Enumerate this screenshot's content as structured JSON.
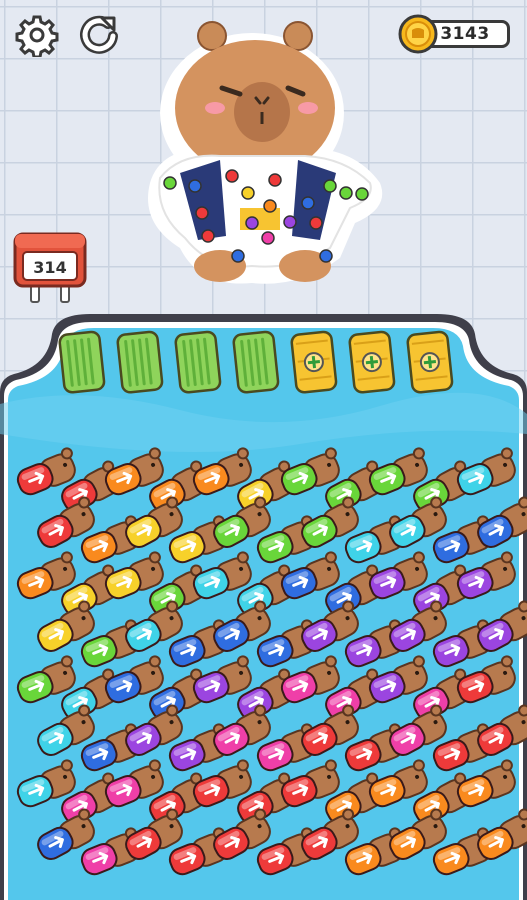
{
  "hud": {
    "settings_icon": "gear-icon",
    "restart_icon": "restart-icon",
    "coins": "3143",
    "coin_icon": "coin-icon"
  },
  "timer": {
    "value": "314"
  },
  "slots": [
    {
      "state": "filled",
      "color": "#8fd45b"
    },
    {
      "state": "filled",
      "color": "#8fd45b"
    },
    {
      "state": "filled",
      "color": "#8fd45b"
    },
    {
      "state": "filled",
      "color": "#8fd45b"
    },
    {
      "state": "locked",
      "color": "#f7c431"
    },
    {
      "state": "locked",
      "color": "#f7c431"
    },
    {
      "state": "locked",
      "color": "#f7c431"
    }
  ],
  "colors": {
    "red": "#ee3a3a",
    "orange": "#f98a1e",
    "yellow": "#f7d12a",
    "green": "#69d63a",
    "cyan": "#3fd3e8",
    "blue": "#2f6de0",
    "purple": "#9b45e0",
    "pink": "#ef3fa8",
    "water": "#54c7ec",
    "capybara": "#b77a4e"
  },
  "tile_rows": [
    [
      "red",
      "red",
      "orange",
      "orange",
      "orange",
      "yellow",
      "green",
      "green",
      "green",
      "green",
      "cyan"
    ],
    [
      "red",
      "orange",
      "yellow",
      "yellow",
      "green",
      "green",
      "green",
      "cyan",
      "cyan",
      "blue",
      "blue"
    ],
    [
      "orange",
      "yellow",
      "yellow",
      "green",
      "cyan",
      "cyan",
      "blue",
      "blue",
      "purple",
      "purple",
      "purple"
    ],
    [
      "yellow",
      "green",
      "cyan",
      "blue",
      "blue",
      "blue",
      "purple",
      "purple",
      "purple",
      "purple",
      "purple"
    ],
    [
      "green",
      "cyan",
      "blue",
      "blue",
      "purple",
      "purple",
      "pink",
      "pink",
      "purple",
      "pink",
      "red"
    ],
    [
      "cyan",
      "blue",
      "purple",
      "purple",
      "pink",
      "pink",
      "red",
      "red",
      "pink",
      "red",
      "red"
    ],
    [
      "cyan",
      "pink",
      "pink",
      "red",
      "red",
      "red",
      "red",
      "orange",
      "orange",
      "orange",
      "orange"
    ],
    [
      "blue",
      "pink",
      "red",
      "red",
      "red",
      "red",
      "red",
      "orange",
      "orange",
      "orange",
      "orange"
    ]
  ]
}
